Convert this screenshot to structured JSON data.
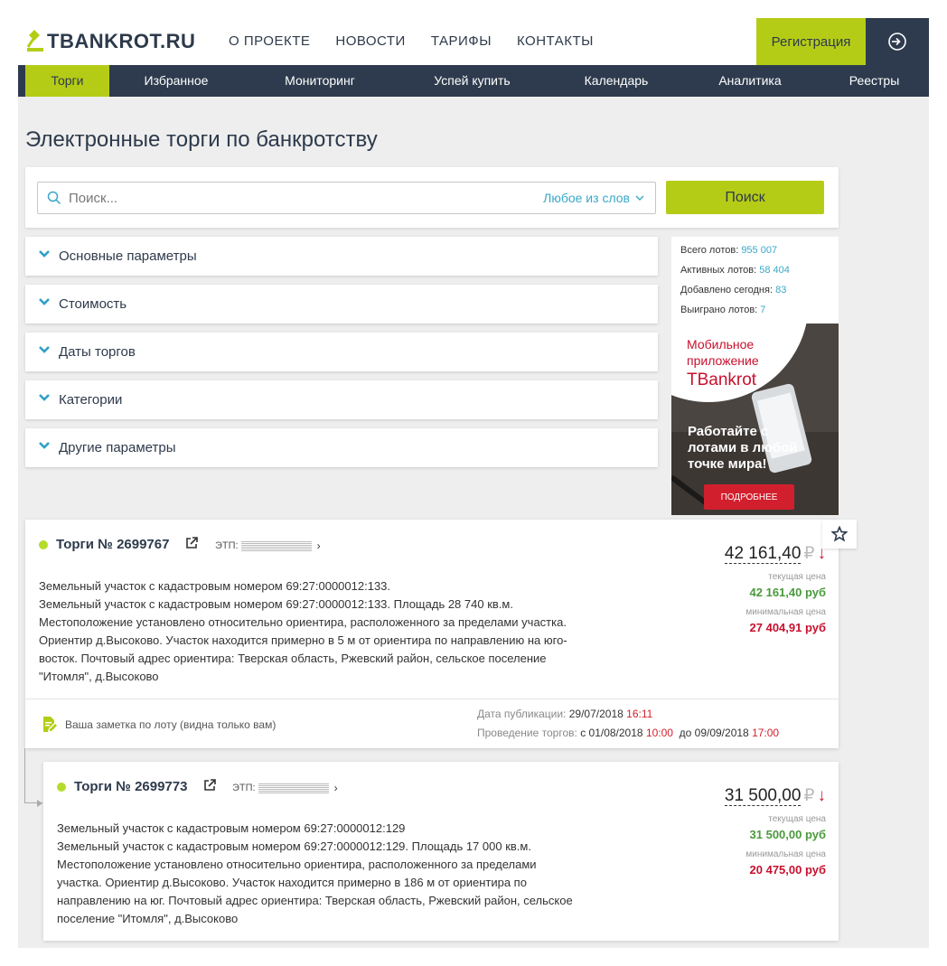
{
  "header": {
    "logo_text": "TBANKROT.RU",
    "nav": [
      "О ПРОЕКТЕ",
      "НОВОСТИ",
      "ТАРИФЫ",
      "КОНТАКТЫ"
    ],
    "register_label": "Регистрация",
    "login_icon": "login-icon"
  },
  "subnav": [
    "Торги",
    "Избранное",
    "Мониторинг",
    "Успей купить",
    "Календарь",
    "Аналитика",
    "Реестры"
  ],
  "page_title": "Электронные торги по банкротству",
  "search": {
    "placeholder": "Поиск...",
    "mode": "Любое из слов",
    "button": "Поиск"
  },
  "filters": [
    "Основные параметры",
    "Стоимость",
    "Даты торгов",
    "Категории",
    "Другие параметры"
  ],
  "stats": {
    "total_label": "Всего лотов:",
    "total": "955 007",
    "active_label": "Активных лотов:",
    "active": "58 404",
    "added_label": "Добавлено сегодня:",
    "added": "83",
    "won_label": "Выиграно лотов:",
    "won": "7"
  },
  "promo": {
    "line1": "Мобильное",
    "line2": "приложение",
    "brand": "TBankrot",
    "slogan1": "Работайте с",
    "slogan2": "лотами в любой",
    "slogan3": "точке мира!",
    "button": "ПОДРОБНЕЕ"
  },
  "lots": [
    {
      "title": "Торги № 2699767",
      "etp_label": "ЭТП:",
      "price": "42 161,40",
      "currency": "₽",
      "current_label": "текущая цена",
      "current": "42 161,40 руб",
      "min_label": "минимальная цена",
      "min": "27 404,91 руб",
      "desc": [
        "Земельный участок с кадастровым номером 69:27:0000012:133.",
        "Земельный участок с кадастровым номером 69:27:0000012:133. Площадь 28 740 кв.м.",
        "Местоположение установлено относительно ориентира, расположенного за пределами участка.",
        "Ориентир д.Высоково. Участок находится примерно в 5 м от ориентира по направлению на юго-",
        "восток. Почтовый адрес ориентира: Тверская область, Ржевский район, сельское поселение",
        "\"Итомля\", д.Высоково"
      ],
      "note": "Ваша заметка по лоту (видна только вам)",
      "pub_label": "Дата публикации:",
      "pub_date": "29/07/2018",
      "pub_time": "16:11",
      "hold_label": "Проведение торгов:",
      "hold_from": "с 01/08/2018",
      "hold_from_time": "10:00",
      "hold_to": "до 09/09/2018",
      "hold_to_time": "17:00"
    },
    {
      "title": "Торги № 2699773",
      "etp_label": "ЭТП:",
      "price": "31 500,00",
      "currency": "₽",
      "current_label": "текущая цена",
      "current": "31 500,00 руб",
      "min_label": "минимальная цена",
      "min": "20 475,00 руб",
      "desc": [
        "Земельный участок с кадастровым номером 69:27:0000012:129",
        "Земельный участок с кадастровым номером 69:27:0000012:129. Площадь 17 000 кв.м.",
        "Местоположение установлено относительно ориентира, расположенного за пределами",
        "участка. Ориентир д.Высоково. Участок находится примерно в 186 м от ориентира по",
        "направлению на юг. Почтовый адрес ориентира: Тверская область, Ржевский район, сельское",
        "поселение \"Итомля\", д.Высоково"
      ]
    }
  ],
  "colors": {
    "accent": "#b5cc17",
    "navy": "#2e3b4e",
    "link": "#3aa8c8",
    "red": "#c8102e",
    "green": "#4a9a3c"
  }
}
